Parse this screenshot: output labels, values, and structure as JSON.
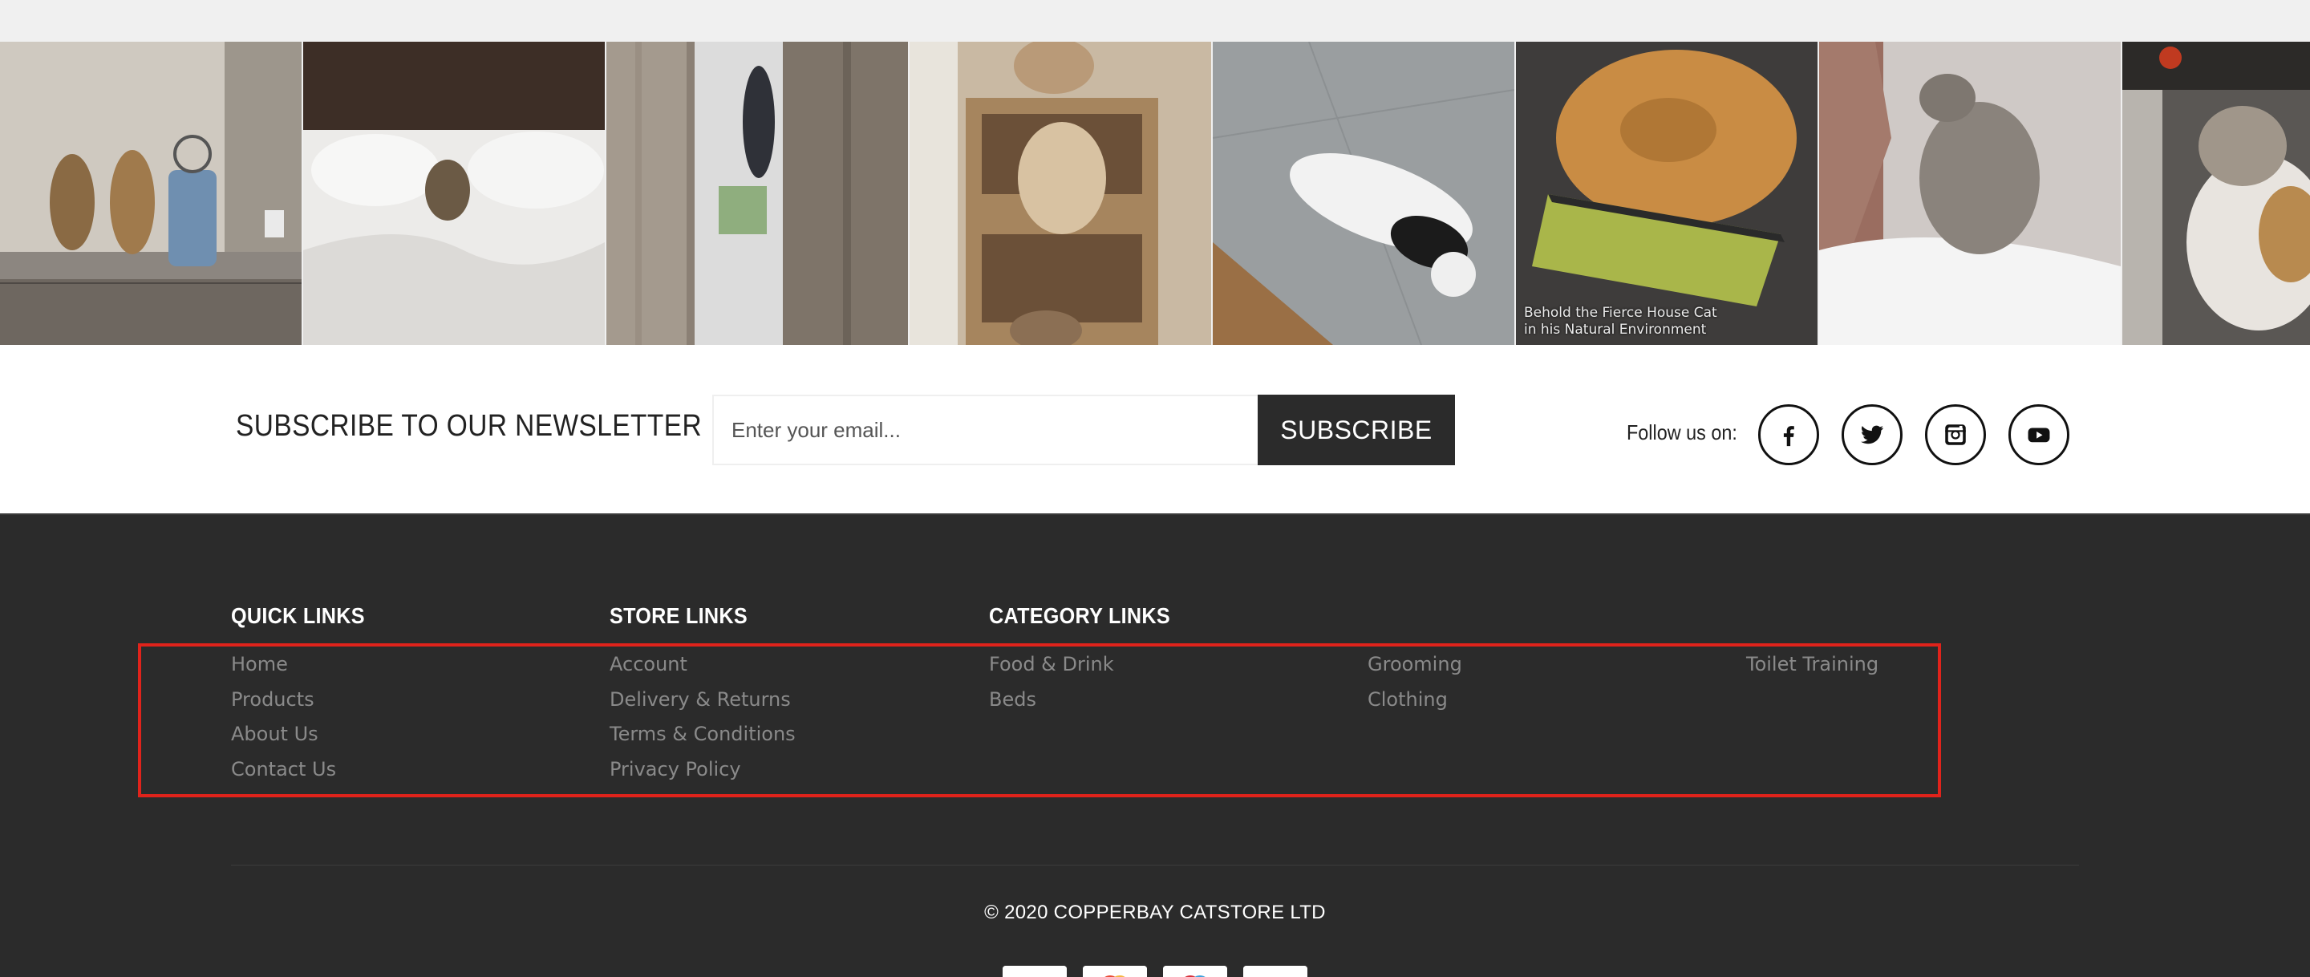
{
  "gallery": {
    "photos": [
      {
        "subject": "two cats standing at bathroom mirror"
      },
      {
        "subject": "cat peeking from white bedding"
      },
      {
        "subject": "black cat climbing curtain"
      },
      {
        "subject": "fluffy cats in cardboard tower"
      },
      {
        "subject": "black and white cat lying on floor"
      },
      {
        "subject": "persian cat on tablet",
        "caption": "Behold the Fierce House Cat\nin his Natural Environment"
      },
      {
        "subject": "kitten on man's shoulder"
      },
      {
        "subject": "calico cat sitting"
      }
    ]
  },
  "newsletter": {
    "title": "SUBSCRIBE TO OUR NEWSLETTER",
    "email_placeholder": "Enter your email...",
    "subscribe_label": "SUBSCRIBE",
    "follow_label": "Follow us on:",
    "socials": [
      {
        "name": "facebook-icon"
      },
      {
        "name": "twitter-icon"
      },
      {
        "name": "instagram-icon"
      },
      {
        "name": "youtube-icon"
      }
    ]
  },
  "footer": {
    "quick_links": {
      "title": "QUICK LINKS",
      "items": [
        "Home",
        "Products",
        "About Us",
        "Contact Us"
      ]
    },
    "store_links": {
      "title": "STORE LINKS",
      "items": [
        "Account",
        "Delivery & Returns",
        "Terms & Conditions",
        "Privacy Policy"
      ]
    },
    "category_links": {
      "title": "CATEGORY LINKS",
      "col1": [
        "Food & Drink",
        "Beds"
      ],
      "col2": [
        "Grooming",
        "Clothing"
      ],
      "col3": [
        "Toilet Training"
      ]
    },
    "copyright": "© 2020 COPPERBAY CATSTORE LTD",
    "payment_icons": [
      "card-icon",
      "mastercard-icon",
      "maestro-icon",
      "card-icon"
    ]
  },
  "colors": {
    "footer_bg": "#2b2b2b",
    "button_bg": "#2b2b2b",
    "highlight": "#e0231b",
    "link_gray": "#8a8a8a"
  }
}
